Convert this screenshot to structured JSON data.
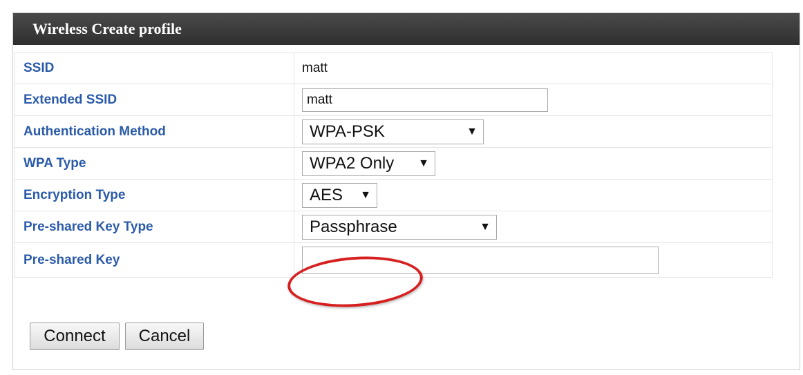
{
  "panel": {
    "title": "Wireless Create profile"
  },
  "form": {
    "ssid": {
      "label": "SSID",
      "value": "matt"
    },
    "extended_ssid": {
      "label": "Extended SSID",
      "value": "matt"
    },
    "auth_method": {
      "label": "Authentication Method",
      "value": "WPA-PSK"
    },
    "wpa_type": {
      "label": "WPA Type",
      "value": "WPA2 Only"
    },
    "encryption_type": {
      "label": "Encryption Type",
      "value": "AES"
    },
    "psk_type": {
      "label": "Pre-shared Key Type",
      "value": "Passphrase"
    },
    "psk": {
      "label": "Pre-shared Key",
      "value": ""
    }
  },
  "buttons": {
    "connect": "Connect",
    "cancel": "Cancel"
  },
  "icons": {
    "dropdown": "chevron-down-icon"
  },
  "colors": {
    "label": "#2a5aa8",
    "title_bar": "#3a3a3a",
    "highlight": "#d62020"
  }
}
